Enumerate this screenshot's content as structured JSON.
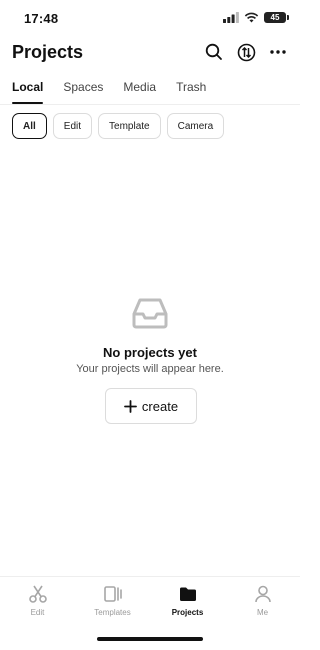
{
  "status": {
    "time": "17:48",
    "battery": "45"
  },
  "header": {
    "title": "Projects"
  },
  "tabs": [
    "Local",
    "Spaces",
    "Media",
    "Trash"
  ],
  "filters": [
    "All",
    "Edit",
    "Template",
    "Camera"
  ],
  "empty_state": {
    "title": "No projects yet",
    "subtitle": "Your projects will appear here.",
    "create_label": "create"
  },
  "bottom_nav": [
    "Edit",
    "Templates",
    "Projects",
    "Me"
  ],
  "colors": {
    "text": "#111111",
    "muted": "#9a9a9a",
    "border": "#dcdcdc",
    "icon_gray": "#b8b8b8"
  }
}
